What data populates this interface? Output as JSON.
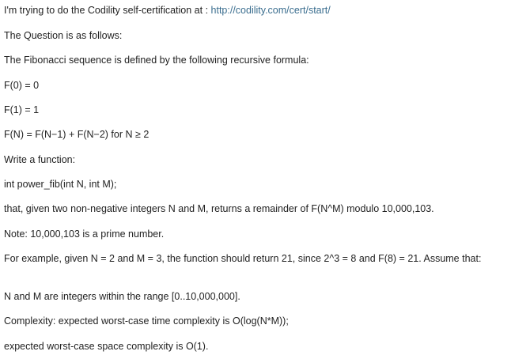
{
  "intro": {
    "text": "I'm trying to do the Codility self-certification at : ",
    "link": "http://codility.com/cert/start/"
  },
  "lines": {
    "question_intro": "The Question is as follows:",
    "fib_def": "The Fibonacci sequence is defined by the following recursive formula:",
    "f0": "F(0) = 0",
    "f1": "F(1) = 1",
    "fn": "F(N) = F(N−1) + F(N−2) for N ≥ 2",
    "write_function": "Write a function:",
    "signature": "int power_fib(int N, int M);",
    "returns": "that, given two non-negative integers N and M, returns a remainder of F(N^M) modulo 10,000,103.",
    "note": "Note: 10,000,103 is a prime number.",
    "example": "For example, given N = 2 and M = 3, the function should return 21, since 2^3 = 8 and F(8) = 21. Assume that:",
    "range": "N and M are integers within the range [0..10,000,000].",
    "time_complexity": "Complexity: expected worst-case time complexity is O(log(N*M));",
    "space_complexity": "expected worst-case space complexity is O(1)."
  },
  "colors": {
    "text": "#222222",
    "link": "#3b6e8f",
    "background": "#ffffff"
  }
}
